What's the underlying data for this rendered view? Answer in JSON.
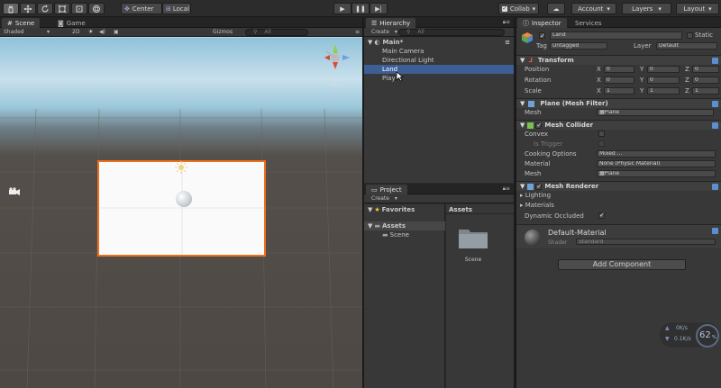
{
  "toolbar": {
    "pivot_label": "Center",
    "space_label": "Local",
    "collab_label": "Collab",
    "account_label": "Account",
    "layers_label": "Layers",
    "layout_label": "Layout"
  },
  "scene": {
    "tab_scene": "Scene",
    "tab_game": "Game",
    "shading_mode": "Shaded",
    "mode_2d": "2D",
    "gizmos_label": "Gizmos",
    "search_placeholder": "All",
    "persp_label": "Iso"
  },
  "hierarchy": {
    "tab": "Hierarchy",
    "create_label": "Create",
    "search_placeholder": "All",
    "scene_name": "Main*",
    "items": [
      "Main Camera",
      "Directional Light",
      "Land",
      "Play"
    ],
    "selected_index": 2
  },
  "project": {
    "tab": "Project",
    "create_label": "Create",
    "favorites": "Favorites",
    "assets": "Assets",
    "scene_folder": "Scene",
    "breadcrumb": "Assets",
    "folder_label": "Scene"
  },
  "inspector": {
    "tab": "Inspector",
    "tab_services": "Services",
    "object_name": "Land",
    "static_label": "Static",
    "tag_label": "Tag",
    "tag_value": "Untagged",
    "layer_label": "Layer",
    "layer_value": "Default",
    "transform": {
      "title": "Transform",
      "position_label": "Position",
      "rotation_label": "Rotation",
      "scale_label": "Scale",
      "position": [
        "0",
        "0",
        "0"
      ],
      "rotation": [
        "0",
        "0",
        "0"
      ],
      "scale": [
        "1",
        "1",
        "1"
      ]
    },
    "mesh_filter": {
      "title": "Plane (Mesh Filter)",
      "mesh_label": "Mesh",
      "mesh_value": "Plane"
    },
    "mesh_collider": {
      "title": "Mesh Collider",
      "convex_label": "Convex",
      "trigger_label": "Is Trigger",
      "cooking_label": "Cooking Options",
      "cooking_value": "Mixed ...",
      "material_label": "Material",
      "material_value": "None (Physic Material)",
      "mesh_label": "Mesh",
      "mesh_value": "Plane"
    },
    "mesh_renderer": {
      "title": "Mesh Renderer",
      "lighting_label": "Lighting",
      "materials_label": "Materials",
      "dynamic_label": "Dynamic Occluded"
    },
    "material": {
      "name": "Default-Material",
      "shader_label": "Shader",
      "shader_value": "Standard"
    },
    "add_component": "Add Component"
  },
  "stats": {
    "up": "0K/s",
    "down": "0.1K/s",
    "percent": "62",
    "percent_unit": "%"
  }
}
